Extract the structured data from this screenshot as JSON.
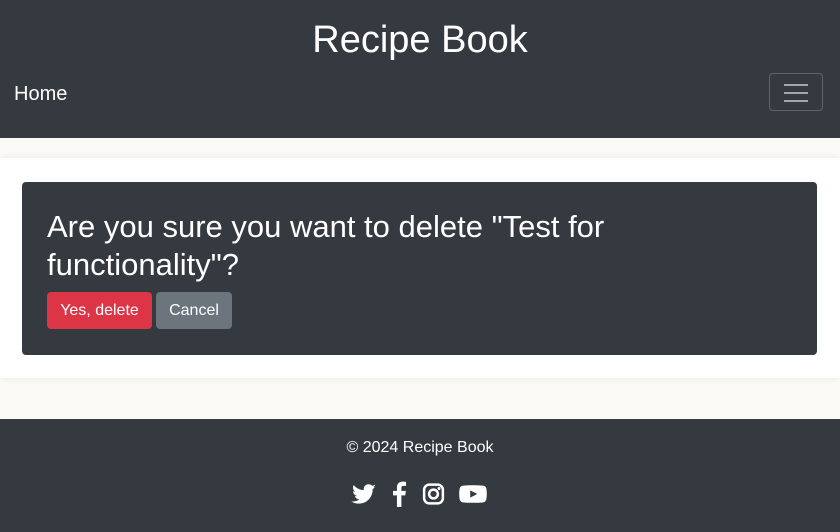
{
  "header": {
    "title": "Recipe Book",
    "nav_home": "Home",
    "toggler_icon": "hamburger-menu-icon"
  },
  "dialog": {
    "title": "Are you sure you want to delete \"Test for functionality\"?",
    "confirm_label": "Yes, delete",
    "cancel_label": "Cancel"
  },
  "footer": {
    "copyright": "© 2024 Recipe Book",
    "social_icons": [
      "twitter-icon",
      "facebook-icon",
      "instagram-icon",
      "youtube-icon"
    ]
  },
  "colors": {
    "dark": "#343a40",
    "danger": "#dc3545",
    "secondary": "#6c757d",
    "page_background": "#fcfaf6"
  }
}
